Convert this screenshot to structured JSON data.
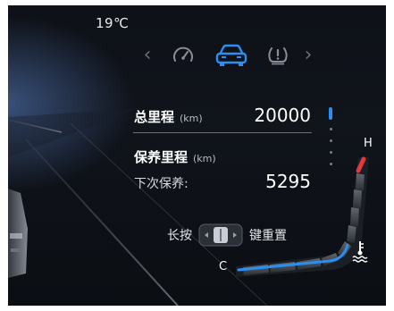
{
  "status": {
    "temperature": "19℃"
  },
  "nav": {
    "prev_icon": "chevron-left-icon",
    "next_icon": "chevron-right-icon",
    "items": [
      {
        "icon": "speedometer-icon",
        "active": false
      },
      {
        "icon": "car-icon",
        "active": true
      },
      {
        "icon": "tire-pressure-warning-icon",
        "active": false
      }
    ],
    "active_color": "#2a8ff0",
    "inactive_color": "#8a8e96"
  },
  "trip": {
    "total_label": "总里程",
    "total_unit": "(km)",
    "total_value": "20000",
    "maint_label": "保养里程",
    "maint_unit": "(km)",
    "next_label": "下次保养:",
    "next_value": "5295"
  },
  "page_indicator": {
    "count": 5,
    "active_index": 0
  },
  "coolant_gauge": {
    "high_label": "H",
    "low_label": "C",
    "icon": "coolant-temperature-icon",
    "level": 0.55,
    "cold_color": "#2a8ff0",
    "hot_color": "#e03a3a"
  },
  "reset_hint": {
    "prefix": "长按",
    "knob_icon": "rocker-knob-icon",
    "suffix": "键重置"
  }
}
